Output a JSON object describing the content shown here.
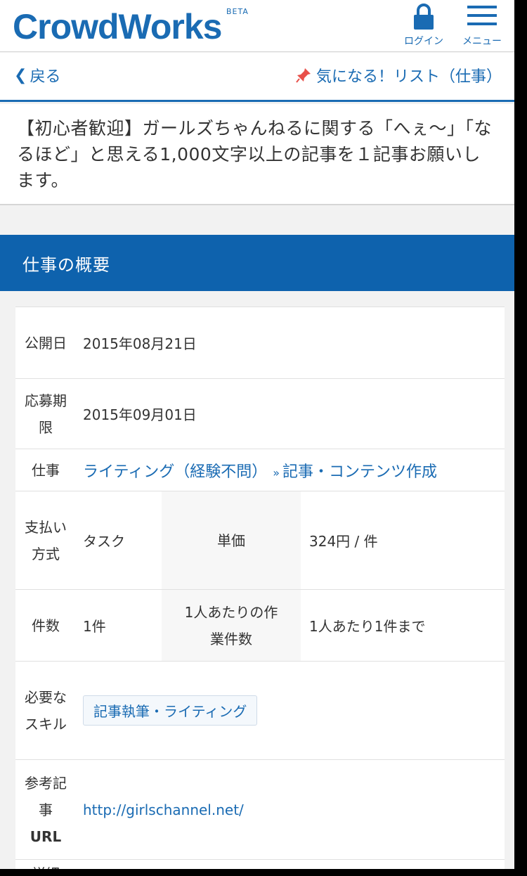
{
  "header": {
    "logo": "CrowdWorks",
    "beta": "BETA",
    "login_label": "ログイン",
    "menu_label": "メニュー",
    "brand_color": "#1a6bb3"
  },
  "nav": {
    "back_label": "戻る",
    "favorite_label": "気になる！リスト（仕事）"
  },
  "job": {
    "title": "【初心者歓迎】ガールズちゃんねるに関する「へぇ～」「なるほど」と思える1,000文字以上の記事を１記事お願いします。"
  },
  "section": {
    "title": "仕事の概要",
    "color": "#0e62ad"
  },
  "details": {
    "published_label": "公開日",
    "published_value": "2015年08月21日",
    "deadline_label": "応募期限",
    "deadline_value": "2015年09月01日",
    "job_label": "仕事",
    "job_category": "ライティング（経験不問）",
    "job_separator": "»",
    "job_subcategory": "記事・コンテンツ作成",
    "payment_label": "支払い方式",
    "payment_value": "タスク",
    "unit_price_label": "単価",
    "unit_price_value": "324円 / 件",
    "count_label": "件数",
    "count_value": "1件",
    "per_person_label": "1人あたりの作業件数",
    "per_person_value": "1人あたり1件まで",
    "skills_label": "必要なスキル",
    "skills": [
      "記事執筆・ライティング"
    ],
    "ref_url_label_1": "参考記事",
    "ref_url_label_2": "URL",
    "ref_url_value": "http://girlschannel.net/",
    "next_label": "詳細"
  }
}
